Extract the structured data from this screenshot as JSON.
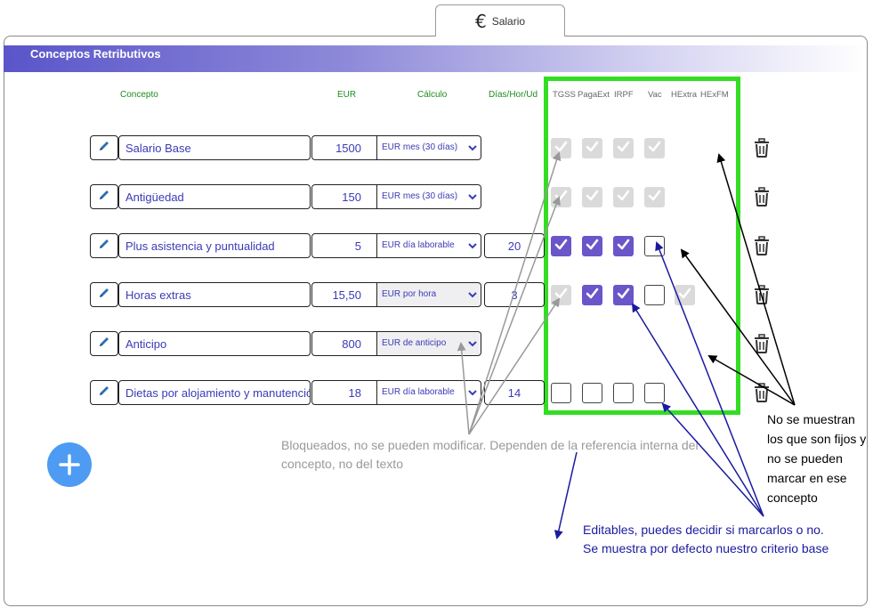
{
  "tab": {
    "icon": "euro-icon",
    "symbol": "€",
    "label": "Salario"
  },
  "section": {
    "title": "Conceptos Retributivos"
  },
  "columns": {
    "concepto": "Concepto",
    "eur": "EUR",
    "calculo": "Cálculo",
    "dias": "Días/Hor/Ud",
    "tgss": "TGSS",
    "pagaext": "PagaExt",
    "irpf": "IRPF",
    "vac": "Vac",
    "hextra": "HExtra",
    "hexfm": "HExFM"
  },
  "rows": [
    {
      "concepto": "Salario Base",
      "eur": "1500",
      "calculo": "EUR mes (30 días)",
      "dias": "",
      "tgss": "disabled",
      "pagaext": "disabled",
      "irpf": "disabled",
      "vac": "disabled",
      "hextra": "none",
      "hexfm": "none"
    },
    {
      "concepto": "Antigüedad",
      "eur": "150",
      "calculo": "EUR mes (30 días)",
      "dias": "",
      "tgss": "disabled",
      "pagaext": "disabled",
      "irpf": "disabled",
      "vac": "disabled",
      "hextra": "none",
      "hexfm": "none"
    },
    {
      "concepto": "Plus asistencia y puntualidad",
      "eur": "5",
      "calculo": "EUR día laborable",
      "dias": "20",
      "tgss": "checked",
      "pagaext": "checked",
      "irpf": "checked",
      "vac": "unchecked",
      "hextra": "none",
      "hexfm": "none"
    },
    {
      "concepto": "Horas extras",
      "eur": "15,50",
      "calculo": "EUR por hora",
      "dias": "3",
      "tgss": "disabled",
      "pagaext": "checked",
      "irpf": "checked",
      "vac": "unchecked",
      "hextra": "disabled",
      "hexfm": "none"
    },
    {
      "concepto": "Anticipo",
      "eur": "800",
      "calculo": "EUR de anticipo",
      "dias": "",
      "tgss": "none",
      "pagaext": "none",
      "irpf": "none",
      "vac": "none",
      "hextra": "none",
      "hexfm": "none"
    },
    {
      "concepto": "Dietas por alojamiento y manutención",
      "eur": "18",
      "calculo": "EUR día laborable",
      "dias": "14",
      "tgss": "unchecked",
      "pagaext": "unchecked",
      "irpf": "unchecked",
      "vac": "unchecked",
      "hextra": "none",
      "hexfm": "none"
    }
  ],
  "annotations": {
    "grey": "Bloqueados, no se pueden modificar. Dependen de la referencia interna del concepto, no del texto",
    "black": "No se muestran los que son fijos y no se pueden marcar en ese concepto",
    "blue_line1": "Editables, puedes decidir si marcarlos o no.",
    "blue_line2": "Se muestra por defecto nuestro criterio base"
  },
  "colors": {
    "accent": "#6a55c9",
    "header_gradient_start": "#5a55c9",
    "text_blue": "#3b3bb5",
    "highlight_green": "#33dd22",
    "add_button": "#4d9bf3",
    "column_green": "#1e8c1e",
    "annotation_grey": "#999999",
    "annotation_blue": "#1a1aa0"
  },
  "icons": {
    "edit": "pencil-icon",
    "delete": "trash-icon",
    "add": "plus-icon",
    "dropdown": "chevron-down-icon",
    "check": "checkmark-icon"
  }
}
